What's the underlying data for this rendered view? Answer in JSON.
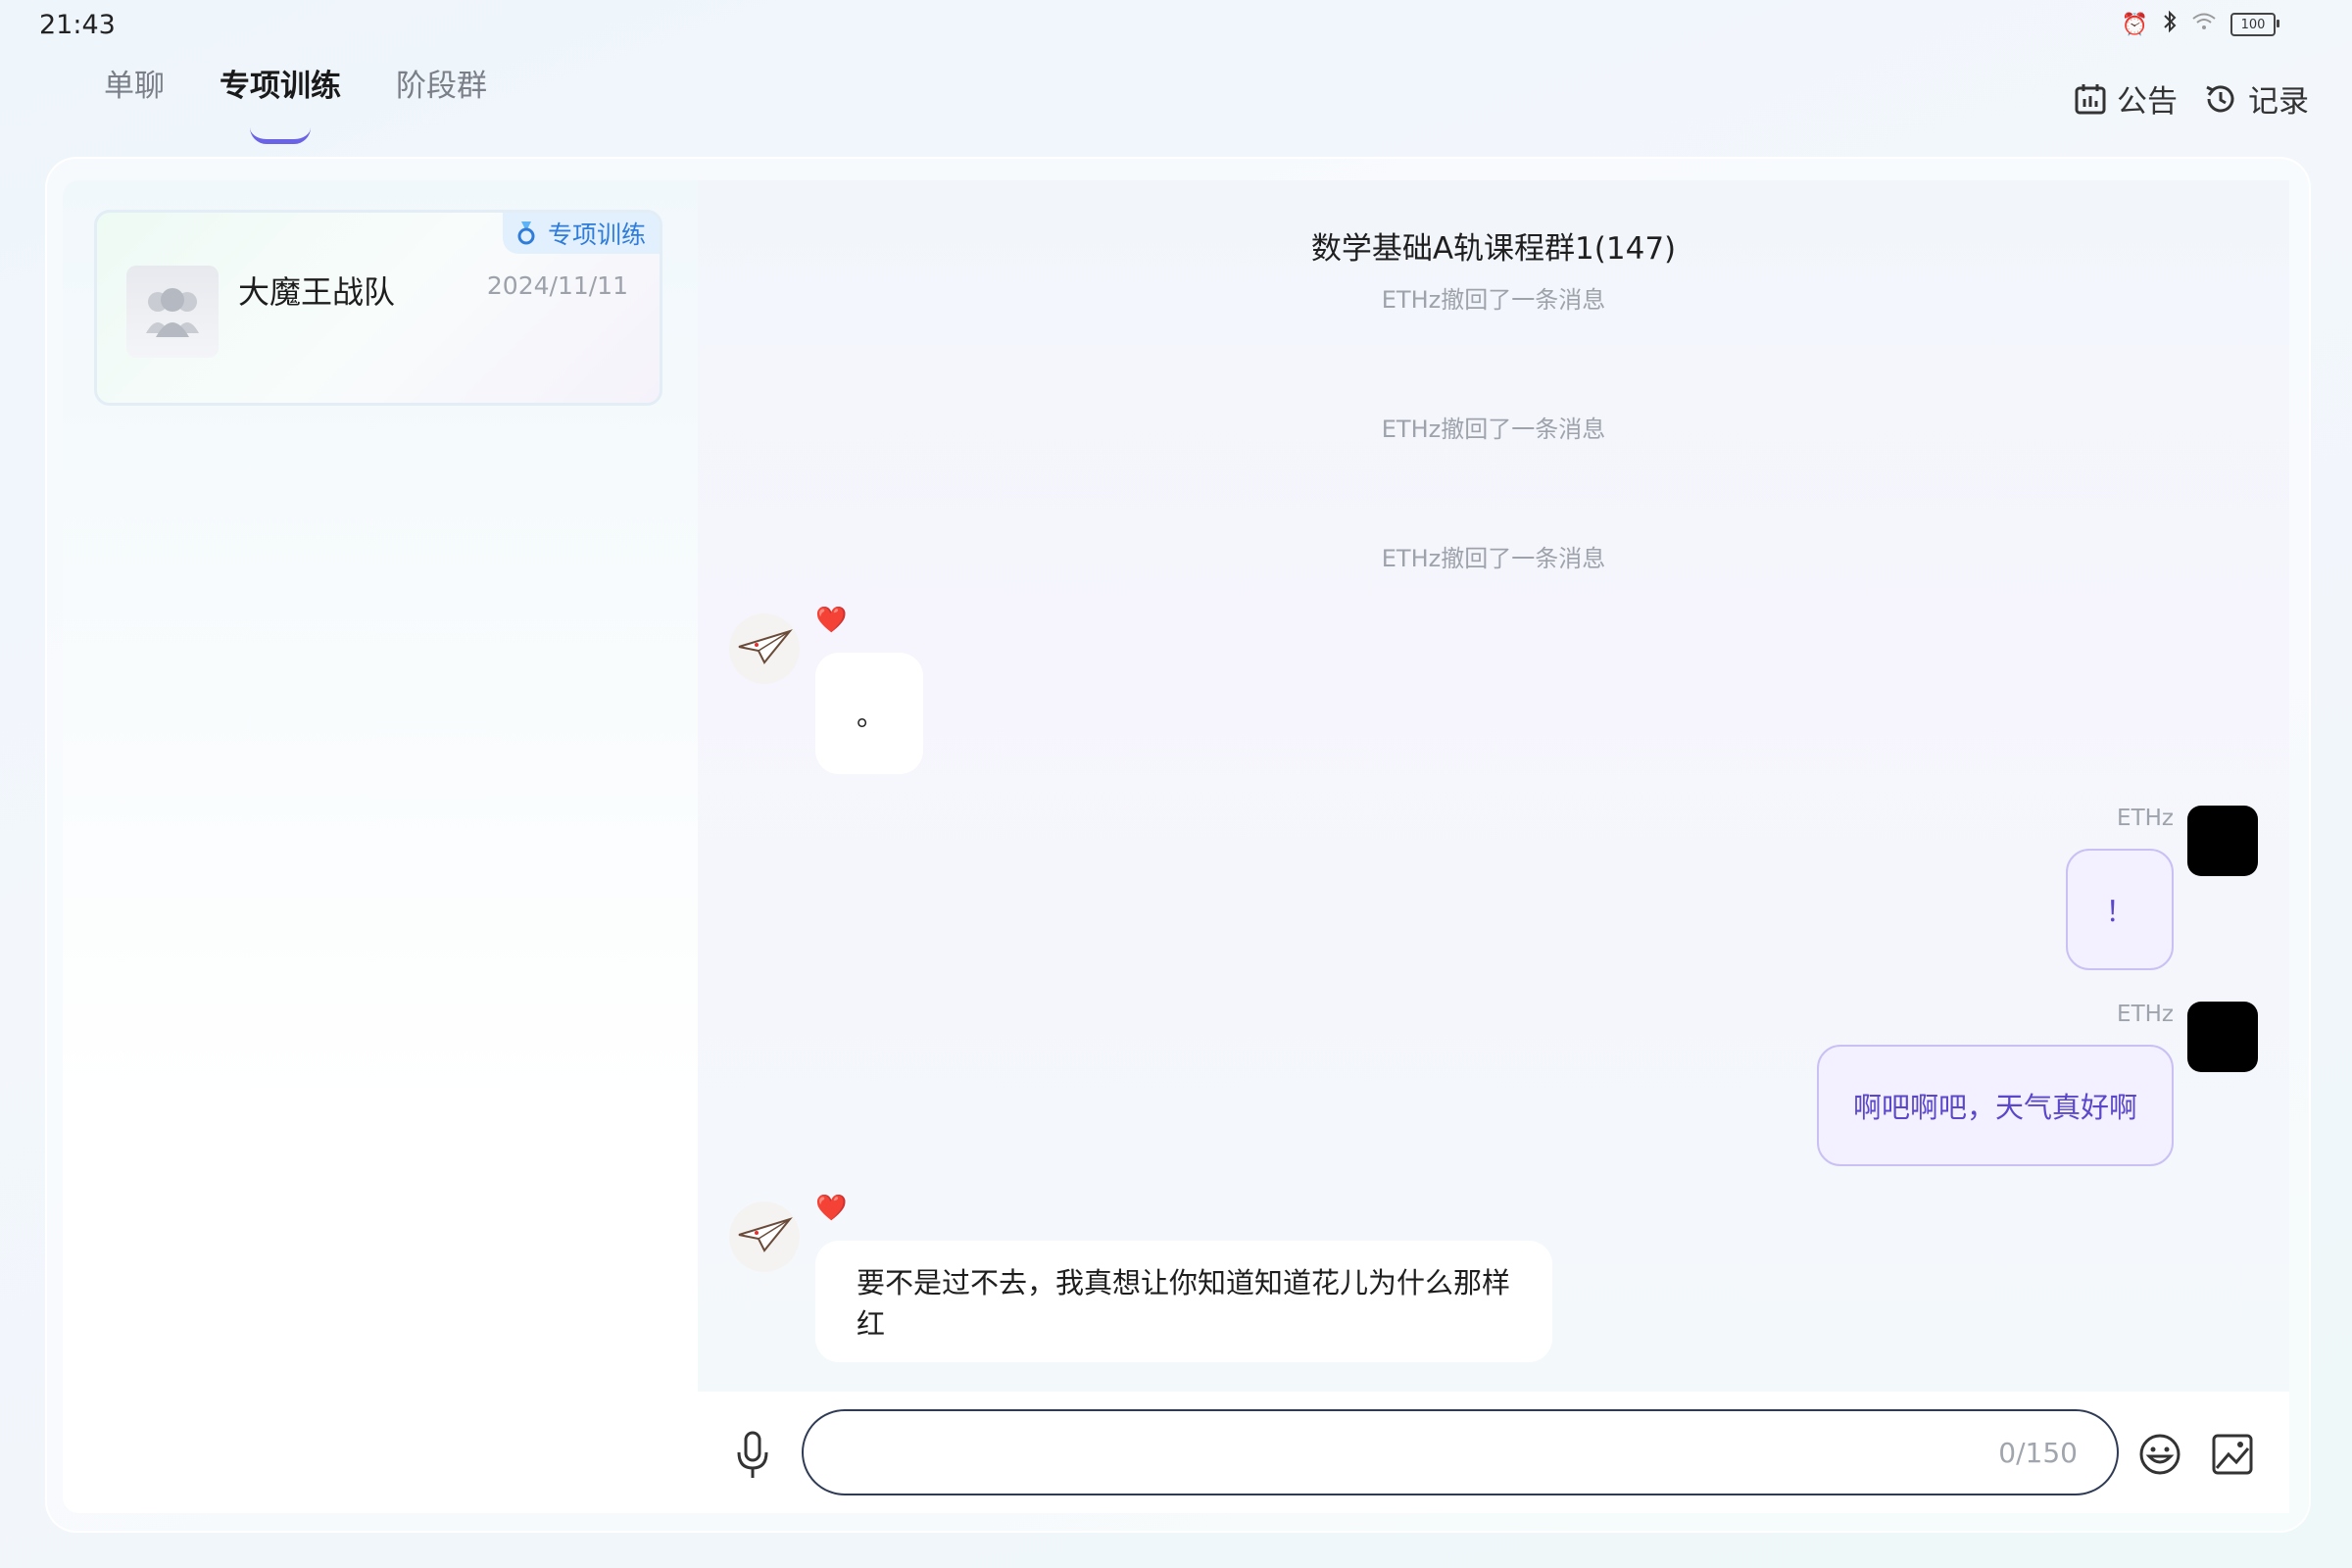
{
  "status_bar": {
    "time": "21:43",
    "battery": "100"
  },
  "tabs": [
    {
      "label": "单聊",
      "active": false
    },
    {
      "label": "专项训练",
      "active": true
    },
    {
      "label": "阶段群",
      "active": false
    }
  ],
  "top_actions": {
    "notice_label": "公告",
    "history_label": "记录"
  },
  "conversation": {
    "badge": "专项训练",
    "name": "大魔王战队",
    "date": "2024/11/11"
  },
  "chat": {
    "title": "数学基础A轨课程群1(147)",
    "system_messages": [
      "ETHz撤回了一条消息",
      "ETHz撤回了一条消息",
      "ETHz撤回了一条消息"
    ],
    "messages": [
      {
        "side": "left",
        "text": "。",
        "reaction": "❤️"
      },
      {
        "side": "right",
        "sender": "ETHz",
        "text": "！"
      },
      {
        "side": "right",
        "sender": "ETHz",
        "text": "啊吧啊吧，天气真好啊"
      },
      {
        "side": "left",
        "text": "要不是过不去，我真想让你知道知道花儿为什么那样红",
        "reaction": "❤️"
      }
    ]
  },
  "input": {
    "counter": "0/150"
  },
  "colors": {
    "accent": "#6b63e6",
    "badge_text": "#2f7cd9",
    "bubble_right_bg": "#f3f0ff",
    "bubble_right_text": "#5a47c9"
  }
}
